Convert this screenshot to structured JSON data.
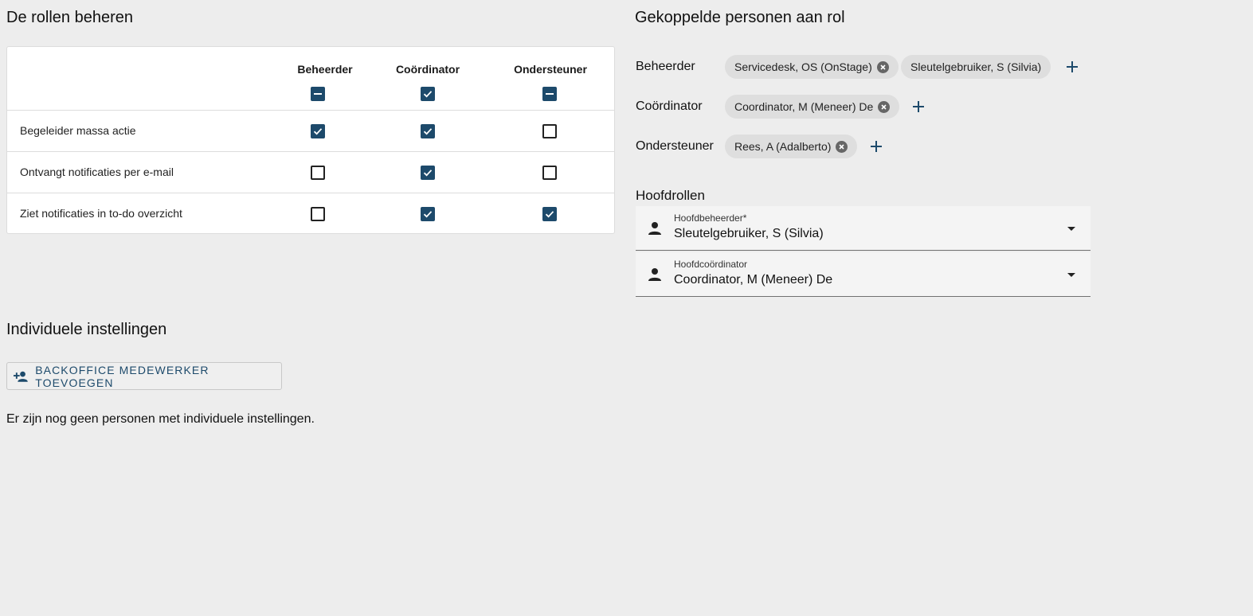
{
  "roles_section": {
    "title": "De rollen beheren",
    "columns": [
      "Beheerder",
      "Coördinator",
      "Ondersteuner"
    ],
    "header_state": [
      "indeterminate",
      "checked",
      "indeterminate"
    ],
    "rows": [
      {
        "label": "Begeleider massa actie",
        "values": [
          true,
          true,
          false
        ]
      },
      {
        "label": "Ontvangt notificaties per e-mail",
        "values": [
          false,
          true,
          false
        ]
      },
      {
        "label": "Ziet notificaties in to-do overzicht",
        "values": [
          false,
          true,
          true
        ]
      }
    ]
  },
  "linked_section": {
    "title": "Gekoppelde personen aan rol",
    "roles": [
      {
        "label": "Beheerder",
        "chips": [
          {
            "text": "Servicedesk, OS (OnStage)",
            "removable": true
          },
          {
            "text": "Sleutelgebruiker, S (Silvia)",
            "removable": false
          }
        ]
      },
      {
        "label": "Coördinator",
        "chips": [
          {
            "text": "Coordinator, M (Meneer) De",
            "removable": true
          }
        ]
      },
      {
        "label": "Ondersteuner",
        "chips": [
          {
            "text": "Rees, A (Adalberto)",
            "removable": true
          }
        ]
      }
    ]
  },
  "main_roles": {
    "title": "Hoofdrollen",
    "fields": [
      {
        "label": "Hoofdbeheerder*",
        "value": "Sleutelgebruiker, S (Silvia)",
        "icon": "person-icon"
      },
      {
        "label": "Hoofdcoördinator",
        "value": "Coordinator, M (Meneer) De",
        "icon": "person-icon"
      }
    ]
  },
  "individual": {
    "title": "Individuele instellingen",
    "add_button": "BACKOFFICE MEDEWERKER TOEVOEGEN",
    "add_icon": "person-add-icon",
    "empty_message": "Er zijn nog geen personen met individuele instellingen."
  },
  "colors": {
    "accent": "#1d4a6b",
    "background": "#ededed"
  }
}
